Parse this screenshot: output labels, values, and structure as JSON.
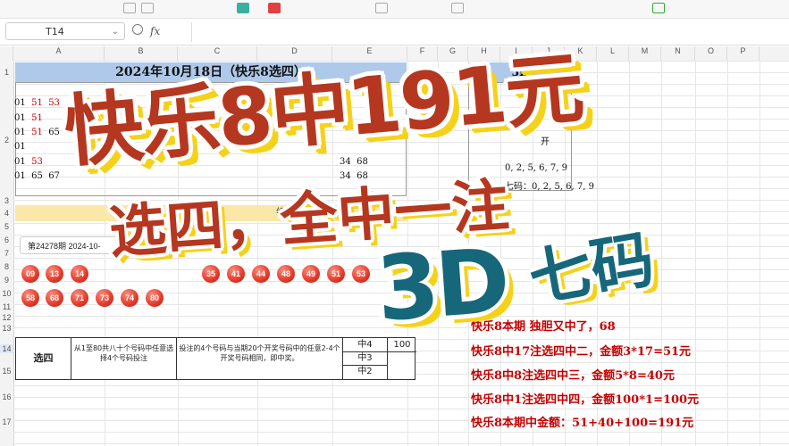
{
  "formula_bar": {
    "cell_ref": "T14",
    "fx_label": "fx"
  },
  "columns": [
    "A",
    "B",
    "C",
    "D",
    "E",
    "F",
    "G",
    "H",
    "I",
    "J",
    "K",
    "L",
    "M",
    "N",
    "O",
    "P"
  ],
  "rows": [
    "1",
    "2",
    "3",
    "4",
    "5",
    "6",
    "7",
    "8",
    "9",
    "10",
    "11",
    "12",
    "13",
    "14",
    "15",
    "16",
    "17"
  ],
  "lottery": {
    "title": "2024年10月18日（快乐8选四）",
    "rows": [
      {
        "a": "01",
        "b": "51",
        "c": "53",
        "tail": "68"
      },
      {
        "a": "01",
        "b": "51",
        "c": "",
        "tail": ""
      },
      {
        "a": "01",
        "b": "51",
        "c": "65",
        "tail": ""
      },
      {
        "a": "01",
        "b": "",
        "c": "",
        "tail": ""
      },
      {
        "a": "01",
        "b": "53",
        "c": "",
        "tail": ""
      },
      {
        "a": "01",
        "b": "65",
        "c": "67",
        "tail": ""
      }
    ],
    "row_e": [
      "34",
      "34"
    ],
    "row_e2": [
      "68",
      "68"
    ],
    "note": "组合号，注意年",
    "period": "第24278期 2024-10-"
  },
  "d3": {
    "title": "3D",
    "kai": "开",
    "line1": "0, 2, 5, 6, 7, 9",
    "line2": "七码：0, 2, 5, 6, 7, 9"
  },
  "balls": {
    "row1": [
      "09",
      "13",
      "14",
      "35",
      "41",
      "44",
      "48",
      "49",
      "51",
      "53"
    ],
    "row2": [
      "58",
      "68",
      "71",
      "73",
      "74",
      "80"
    ]
  },
  "rules": {
    "name": "选四",
    "desc": "从1至80共八十个号码中任意选择4个号码投注",
    "prize_rule": "投注的4个号码与当期20个开奖号码中的任意2-4个开奖号码相同，即中奖。",
    "levels": [
      "中4",
      "中3",
      "中2"
    ],
    "amount": "100"
  },
  "wins": [
    "快乐8本期 独胆又中了，68",
    "快乐8中17注选四中二，金额3*17=51元",
    "快乐8中8注选四中三，金额5*8=40元",
    "快乐8中1注选四中四，金额100*1=100元",
    "快乐8本期中金额：51+40+100=191元"
  ],
  "overlay": {
    "headline": "快乐8中191元",
    "subline": "选四，全中一注",
    "d3_big": "3D",
    "d3_sub": "七码"
  },
  "colors": {
    "headline_red": "#b5371f",
    "teal": "#17677a",
    "outline_yellow": "#f5d21a",
    "win_red": "#c40000",
    "ball_red": "#e23a2a"
  }
}
